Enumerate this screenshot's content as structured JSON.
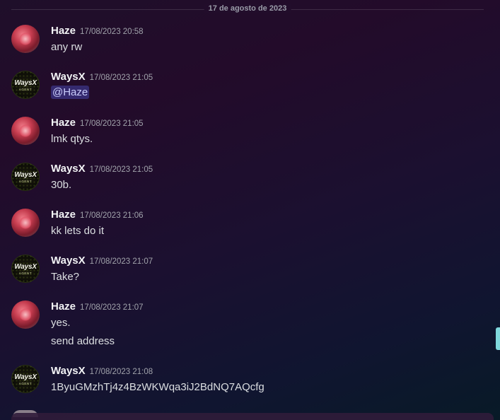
{
  "date_divider": "17 de agosto de 2023",
  "messages": [
    {
      "author": "Haze",
      "avatar": "haze",
      "time": "17/08/2023 20:58",
      "lines": [
        "any rw"
      ]
    },
    {
      "author": "WaysX",
      "avatar": "waysx",
      "time": "17/08/2023 21:05",
      "mention": "@Haze"
    },
    {
      "author": "Haze",
      "avatar": "haze",
      "time": "17/08/2023 21:05",
      "lines": [
        "lmk qtys."
      ]
    },
    {
      "author": "WaysX",
      "avatar": "waysx",
      "time": "17/08/2023 21:05",
      "lines": [
        "30b."
      ]
    },
    {
      "author": "Haze",
      "avatar": "haze",
      "time": "17/08/2023 21:06",
      "lines": [
        "kk lets do it"
      ]
    },
    {
      "author": "WaysX",
      "avatar": "waysx",
      "time": "17/08/2023 21:07",
      "lines": [
        "Take?"
      ]
    },
    {
      "author": "Haze",
      "avatar": "haze",
      "time": "17/08/2023 21:07",
      "lines": [
        "yes.",
        "send address"
      ]
    },
    {
      "author": "WaysX",
      "avatar": "waysx",
      "time": "17/08/2023 21:08",
      "lines": [
        "1ByuGMzhTj4z4BzWKWqa3iJ2BdNQ7AQcfg"
      ]
    }
  ],
  "waysx_avatar": {
    "logo_text": "WaysX",
    "sub_text": "AGENT"
  },
  "colors": {
    "mention_bg": "#5865f2",
    "scroll_thumb": "#7fd8dc",
    "username": "#f2f3f5",
    "timestamp": "#a1a3ab"
  }
}
